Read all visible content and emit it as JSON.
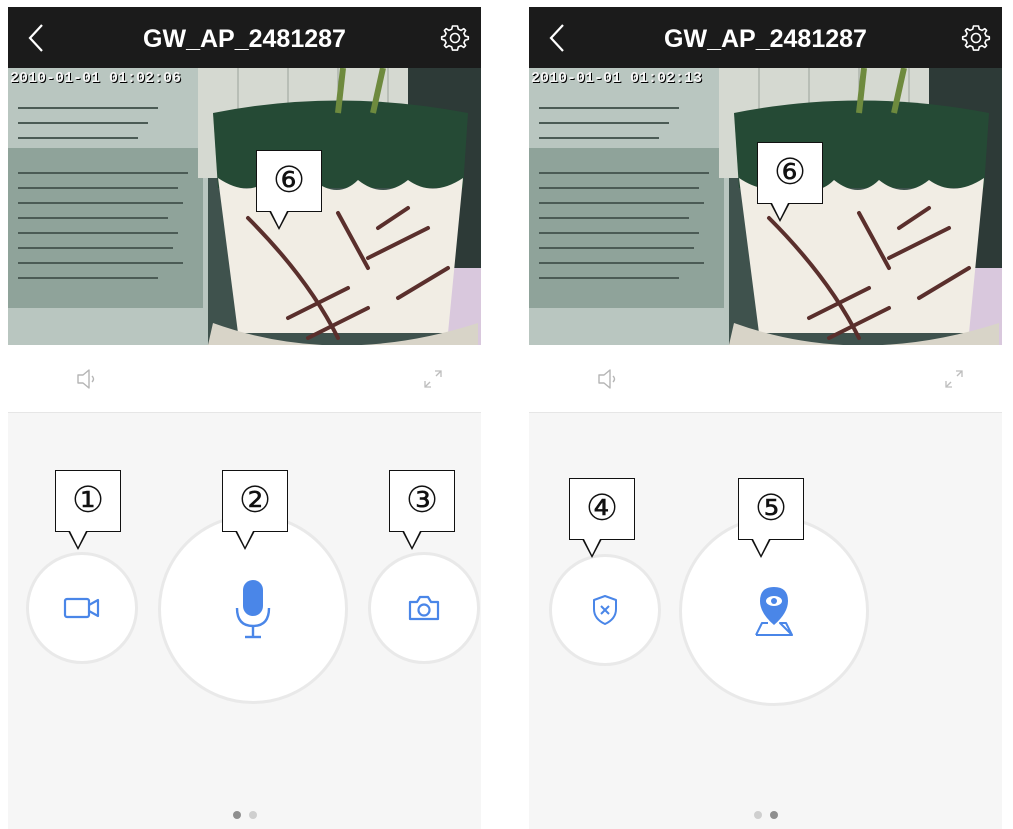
{
  "screens": [
    {
      "title": "GW_AP_2481287",
      "timestamp": "2010-01-01 01:02:06",
      "callouts": {
        "video": "⑥",
        "record": "①",
        "talk": "②",
        "snapshot": "③"
      },
      "pager": {
        "active_index": 0,
        "count": 2
      }
    },
    {
      "title": "GW_AP_2481287",
      "timestamp": "2010-01-01 01:02:13",
      "callouts": {
        "video": "⑥",
        "disarm": "④",
        "location": "⑤"
      },
      "pager": {
        "active_index": 1,
        "count": 2
      }
    }
  ],
  "icons": {
    "back": "back-chevron-icon",
    "settings": "gear-icon",
    "speaker": "speaker-icon",
    "fullscreen": "fullscreen-icon",
    "record": "video-camera-icon",
    "talk": "microphone-icon",
    "snapshot": "camera-icon",
    "disarm": "shield-x-icon",
    "location": "map-pin-eye-icon"
  },
  "colors": {
    "topbar": "#1b1b1b",
    "accent_blue": "#4a86e8",
    "action_bg": "#f6f6f6",
    "circle_border": "#e9e9e9",
    "dot_active": "#8f8f8f",
    "dot_inactive": "#cfcfcf"
  }
}
